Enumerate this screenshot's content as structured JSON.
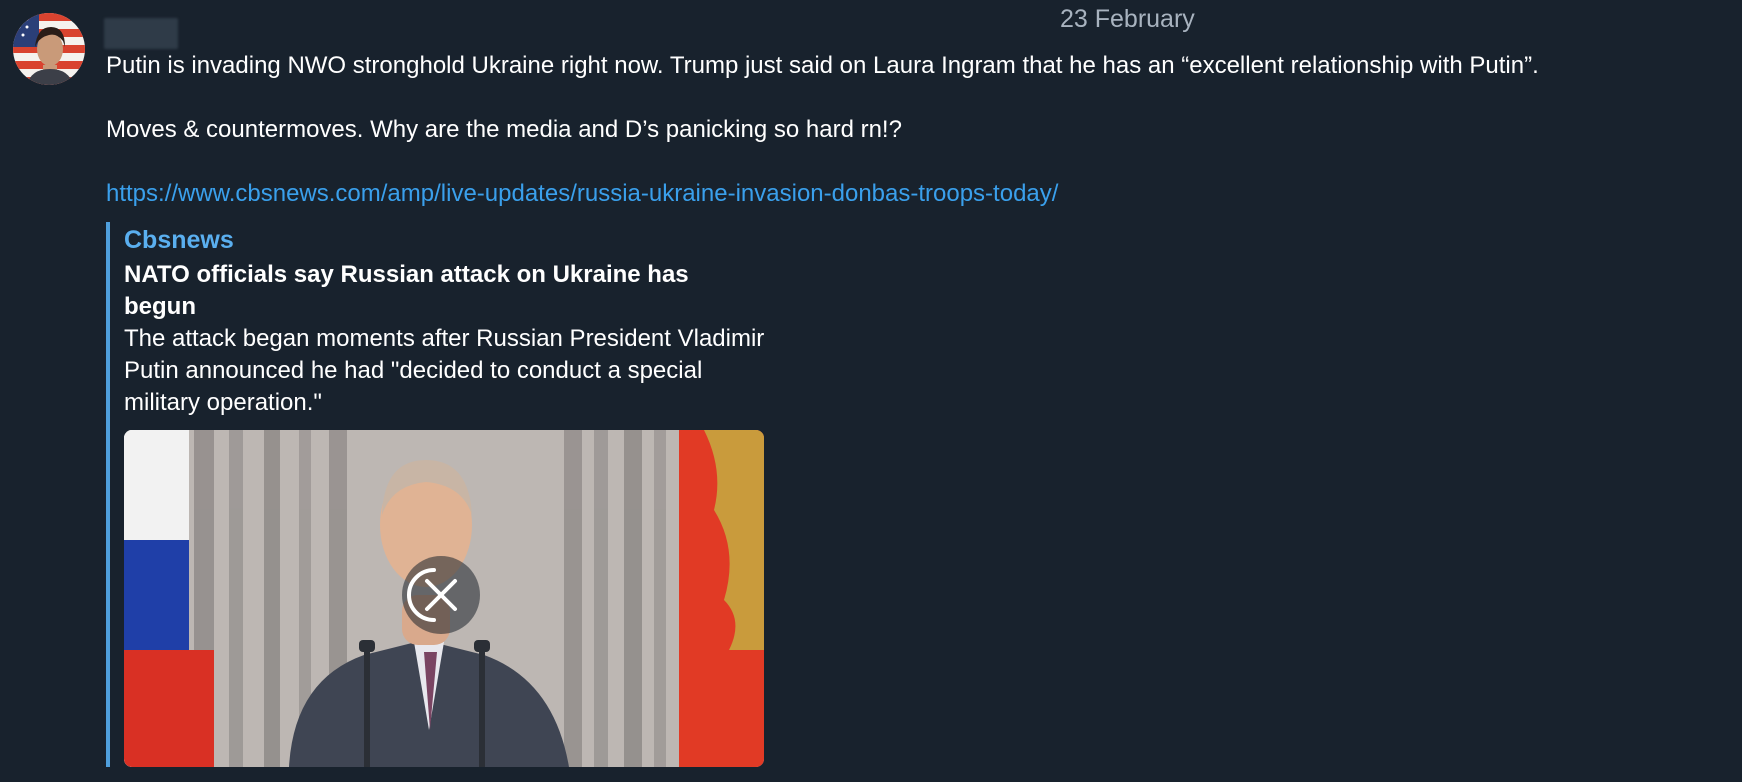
{
  "message": {
    "date": "23 February",
    "text_line_1": "Putin is invading NWO stronghold Ukraine right now. Trump just said on Laura Ingram that he has an “excellent relationship with Putin”.",
    "text_line_2": "Moves & countermoves. Why are the media and D’s panicking so hard rn!?",
    "link": "https://www.cbsnews.com/amp/live-updates/russia-ukraine-invasion-donbas-troops-today/"
  },
  "link_preview": {
    "site_name": "Cbsnews",
    "title": "NATO officials say Russian attack on Ukraine has begun",
    "description": "The attack began moments after Russian President Vladimir Putin announced he had \"decided to conduct a special military operation.\""
  },
  "icons": {
    "avatar": "user-avatar",
    "download_cancel": "close-icon"
  },
  "colors": {
    "background": "#18222d",
    "link": "#3aa0ec",
    "accent": "#4f9fdc",
    "date": "#a8b3bf"
  }
}
